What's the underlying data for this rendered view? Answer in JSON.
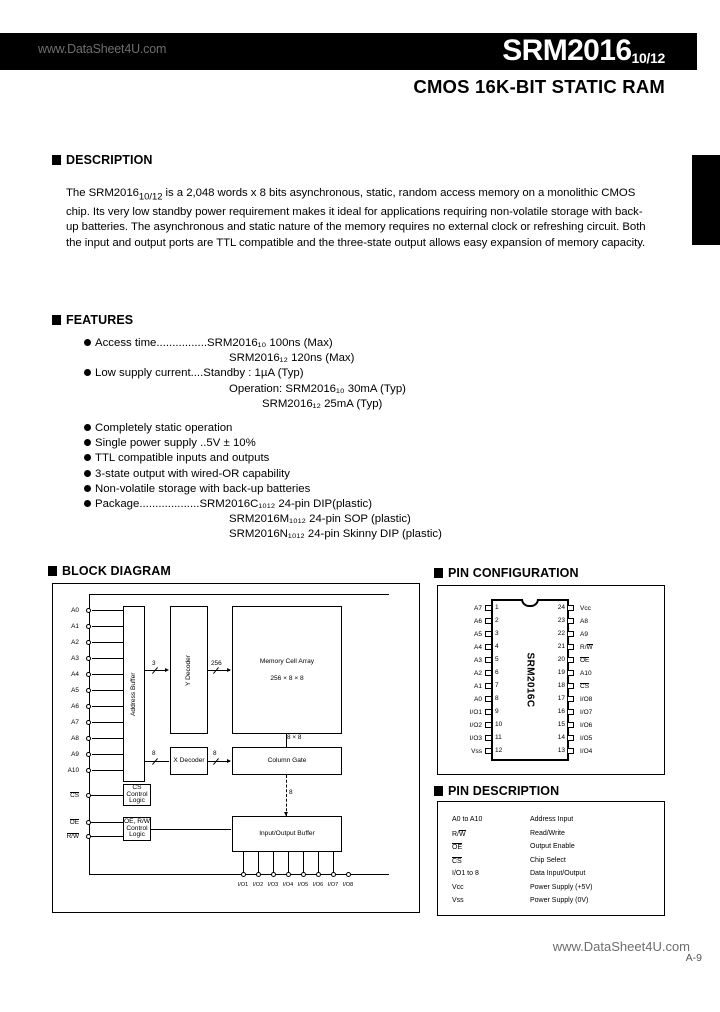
{
  "header": {
    "watermark": "www.DataSheet4U.com",
    "part_number": "SRM2016",
    "part_suffix": "10/12",
    "subtitle": "CMOS 16K-BIT STATIC RAM"
  },
  "description": {
    "heading": "DESCRIPTION",
    "body_html": "The SRM2016<sub>10/12</sub> is a 2,048 words x 8 bits asynchronous, static, random access memory on a monolithic CMOS chip. Its very low standby power requirement makes it ideal for applications requiring non-volatile storage with back-up batteries. The asynchronous and static nature of the memory requires no external clock or refreshing circuit.  Both the input and output ports are TTL compatible and the three-state output allows easy expansion of memory capacity."
  },
  "features": {
    "heading": "FEATURES",
    "items": [
      {
        "label": "Access time",
        "dots": "................",
        "value": "SRM2016₁₀ 100ns (Max)"
      },
      {
        "cont": "SRM2016₁₂ 120ns (Max)"
      },
      {
        "label": "Low supply current",
        "dots": "....",
        "value": "Standby : 1µA (Typ)"
      },
      {
        "cont": "Operation:  SRM2016₁₀   30mA (Typ)"
      },
      {
        "cont2": "SRM2016₁₂   25mA (Typ)"
      },
      {
        "label": "Completely static operation"
      },
      {
        "label": "Single power supply ..5V ± 10%"
      },
      {
        "label": "TTL compatible inputs and outputs"
      },
      {
        "label": "3-state output with wired-OR capability"
      },
      {
        "label": "Non-volatile storage with back-up batteries"
      },
      {
        "label": "Package",
        "dots": "...................",
        "value": "SRM2016C₁₀₁₂ 24-pin DIP(plastic)"
      },
      {
        "cont": "SRM2016M₁₀₁₂ 24-pin SOP (plastic)"
      },
      {
        "cont": "SRM2016N₁₀₁₂ 24-pin Skinny DIP (plastic)"
      }
    ]
  },
  "block_diagram": {
    "heading": "BLOCK DIAGRAM",
    "blocks": {
      "address_buffer": "Address Buffer",
      "y_decoder": "Y Decoder",
      "memory_cell_array_line1": "Memory Cell Array",
      "memory_cell_array_line2": "256 × 8 × 8",
      "x_decoder": "X Decoder",
      "column_gate": "Column Gate",
      "io_buffer": "Input/Output Buffer",
      "cs_logic_line1": "CS",
      "cs_logic_line2": "Control",
      "cs_logic_line3": "Logic",
      "oe_logic_line1": "OE, R/W",
      "oe_logic_line2": "Control",
      "oe_logic_line3": "Logic"
    },
    "address_pins": [
      "A0",
      "A1",
      "A2",
      "A3",
      "A4",
      "A5",
      "A6",
      "A7",
      "A8",
      "A9",
      "A10"
    ],
    "control_pins": [
      "CS",
      "OE",
      "R/W"
    ],
    "io_pins": [
      "I/O1",
      "I/O2",
      "I/O3",
      "I/O4",
      "I/O5",
      "I/O6",
      "I/O7",
      "I/O8"
    ],
    "bus_labels": {
      "addr_to_y": "3",
      "y_to_array": "256",
      "addr_to_x": "8",
      "x_to_gate": "8",
      "array_to_gate": "8 × 8",
      "gate_to_io": "8"
    }
  },
  "pin_configuration": {
    "heading": "PIN CONFIGURATION",
    "chip_label": "SRM2016C",
    "left_pins": [
      {
        "num": "1",
        "name": "A7"
      },
      {
        "num": "2",
        "name": "A6"
      },
      {
        "num": "3",
        "name": "A5"
      },
      {
        "num": "4",
        "name": "A4"
      },
      {
        "num": "5",
        "name": "A3"
      },
      {
        "num": "6",
        "name": "A2"
      },
      {
        "num": "7",
        "name": "A1"
      },
      {
        "num": "8",
        "name": "A0"
      },
      {
        "num": "9",
        "name": "I/O1"
      },
      {
        "num": "10",
        "name": "I/O2"
      },
      {
        "num": "11",
        "name": "I/O3"
      },
      {
        "num": "12",
        "name": "Vss"
      }
    ],
    "right_pins": [
      {
        "num": "24",
        "name": "Vcc"
      },
      {
        "num": "23",
        "name": "A8"
      },
      {
        "num": "22",
        "name": "A9"
      },
      {
        "num": "21",
        "name": "R/W"
      },
      {
        "num": "20",
        "name": "OE"
      },
      {
        "num": "19",
        "name": "A10"
      },
      {
        "num": "18",
        "name": "CS"
      },
      {
        "num": "17",
        "name": "I/O8"
      },
      {
        "num": "16",
        "name": "I/O7"
      },
      {
        "num": "15",
        "name": "I/O6"
      },
      {
        "num": "14",
        "name": "I/O5"
      },
      {
        "num": "13",
        "name": "I/O4"
      }
    ]
  },
  "pin_description": {
    "heading": "PIN DESCRIPTION",
    "rows": [
      {
        "symbol": "A0 to A10",
        "text": "Address Input"
      },
      {
        "symbol": "R/W",
        "text": "Read/Write"
      },
      {
        "symbol": "OE",
        "text": "Output Enable"
      },
      {
        "symbol": "CS",
        "text": "Chip Select"
      },
      {
        "symbol": "I/O1 to 8",
        "text": "Data Input/Output"
      },
      {
        "symbol": "Vcc",
        "text": "Power Supply (+5V)"
      },
      {
        "symbol": "Vss",
        "text": "Power Supply (0V)"
      }
    ]
  },
  "footer": {
    "watermark": "www.DataSheet4U.com",
    "page_number": "A-9"
  }
}
